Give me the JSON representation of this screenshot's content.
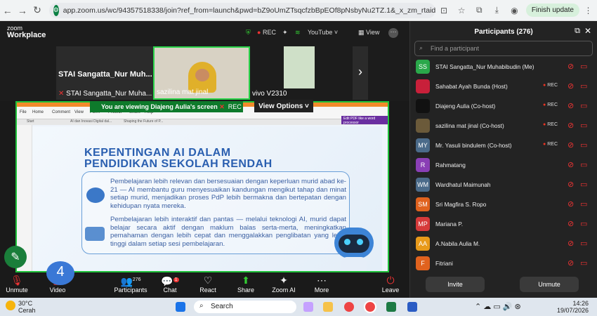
{
  "browser": {
    "url": "app.zoom.us/wc/94357518338/join?ref_from=launch&pwd=bZ9oUmZTsqcfzbBpEOf8pNsbyNu2TZ.1&_x_zm_rtaid=pFT4FvErQ...",
    "finish_label": "Finish update"
  },
  "zoom": {
    "logo_line1": "zoom",
    "logo_line2": "Workplace",
    "rec": "REC",
    "youtube": "YouTube",
    "view": "View"
  },
  "videos": {
    "tile1_big": "STAI Sangatta_Nur Muh...",
    "tile1_name": "STAI Sangatta_Nur Muha...",
    "tile2_name": "sazilina mat jinal",
    "tile3_name": "vivo V2310"
  },
  "share": {
    "banner": "You are viewing  Diajeng Aulia's screen",
    "banner_rec": "REC",
    "view_options": "View Options",
    "menu": [
      "File",
      "Home",
      "Comment",
      "View",
      "Form",
      "Protect",
      "Share",
      "Help"
    ],
    "tabs": [
      "Start",
      "AI dan Inovasi Digital dal...",
      "Shaping the Future of P..."
    ],
    "edit_pdf": "Edit PDF like a word processor",
    "title_line1": "KEPENTINGAN AI DALAM",
    "title_line2": "PENDIDIKAN SEKOLAH RENDAH",
    "para1": "Pembelajaran lebih relevan dan bersesuaian dengan keperluan murid abad ke-21 — AI membantu guru menyesuaikan kandungan mengikut tahap dan minat setiap murid, menjadikan proses PdP lebih bermakna dan bertepatan dengan kehidupan nyata mereka.",
    "para2": "Pembelajaran lebih interaktif dan pantas — melalui teknologi AI, murid dapat belajar secara aktif dengan maklum balas serta-merta, meningkatkan pemahaman dengan lebih cepat dan menggalakkan penglibatan yang lebih tinggi dalam setiap sesi pembelajaran.",
    "page_badge": "4"
  },
  "toolbar": {
    "unmute": "Unmute",
    "video": "Video",
    "participants": "Participants",
    "participants_count": "276",
    "chat": "Chat",
    "chat_badge": "1",
    "react": "React",
    "share": "Share",
    "zoom_ai": "Zoom AI",
    "more": "More",
    "leave": "Leave"
  },
  "panel": {
    "title": "Participants (276)",
    "search_placeholder": "Find a participant",
    "invite": "Invite",
    "unmute": "Unmute",
    "participants": [
      {
        "initials": "SS",
        "name": "STAI Sangatta_Nur Muhabibudin (Me)",
        "color": "#2aa84a",
        "rec": ""
      },
      {
        "initials": "",
        "name": "Sahabat Ayah Bunda (Host)",
        "color": "#c8203a",
        "rec": "REC"
      },
      {
        "initials": "",
        "name": "Diajeng Aulia (Co-host)",
        "color": "#111111",
        "rec": "REC"
      },
      {
        "initials": "",
        "name": "sazilina mat jinal (Co-host)",
        "color": "#6b5a3a",
        "rec": "REC"
      },
      {
        "initials": "MY",
        "name": "Mr. Yasuli bindulem (Co-host)",
        "color": "#4b6b8a",
        "rec": "REC"
      },
      {
        "initials": "R",
        "name": "Rahmatang",
        "color": "#8a3fb5",
        "rec": ""
      },
      {
        "initials": "WM",
        "name": "Wardhatul Maimunah",
        "color": "#4b6b8a",
        "rec": ""
      },
      {
        "initials": "SM",
        "name": "Sri Magfira S. Ropo",
        "color": "#e0621e",
        "rec": ""
      },
      {
        "initials": "MP",
        "name": "Mariana P.",
        "color": "#d63a3a",
        "rec": ""
      },
      {
        "initials": "AA",
        "name": "A.Nabila Aulia M.",
        "color": "#e89a1a",
        "rec": ""
      },
      {
        "initials": "F",
        "name": "Fitriani",
        "color": "#e0621e",
        "rec": ""
      }
    ]
  },
  "taskbar": {
    "temp": "30°C",
    "weather": "Cerah",
    "search": "Search",
    "time": "14:26",
    "date": "19/07/2026"
  }
}
